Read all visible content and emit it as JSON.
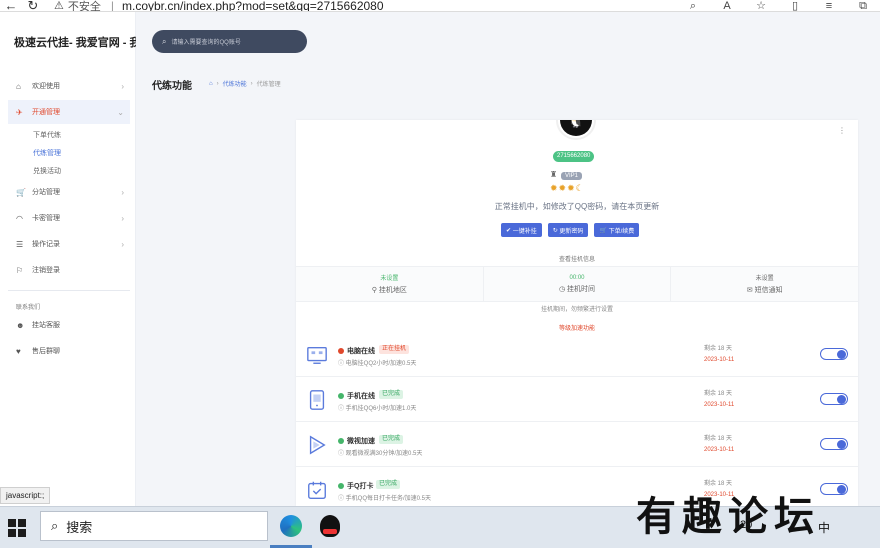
{
  "browser": {
    "back_icon": "back-arrow-icon",
    "reload_icon": "reload-icon",
    "insecure_label": "不安全",
    "url": "m.coybr.cn/index.php?mod=set&qq=2715662080"
  },
  "sidebar": {
    "brand": "极速云代挂- 我爱官网 - 我",
    "items": [
      {
        "label": "欢迎使用",
        "icon": "home-icon"
      },
      {
        "label": "开通管理",
        "icon": "rocket-icon"
      },
      {
        "label": "分站管理",
        "icon": "cart-icon"
      },
      {
        "label": "卡密管理",
        "icon": "wifi-icon"
      },
      {
        "label": "操作记录",
        "icon": "list-icon"
      },
      {
        "label": "注销登录",
        "icon": "logout-icon"
      }
    ],
    "sub_items": [
      "下单代练",
      "代练管理",
      "兑换活动"
    ],
    "section_label": "联系我们",
    "contact_items": [
      {
        "label": "挂站客服",
        "icon": "support-icon"
      },
      {
        "label": "售后群聊",
        "icon": "heart-icon"
      }
    ]
  },
  "search": {
    "placeholder": "请输入需要查询的QQ账号"
  },
  "page": {
    "title": "代练功能",
    "crumbs": [
      "代练功能",
      "代练管理"
    ]
  },
  "card": {
    "qq": "2715662080",
    "vip_label": "VIP1",
    "status_text": "正常挂机中，如修改了QQ密码，请在本页更新",
    "buttons": [
      "一键补挂",
      "更新密码",
      "下单/续费"
    ],
    "caption": "查看挂机信息",
    "stats": [
      {
        "value": "未设置",
        "label": "挂机地区"
      },
      {
        "value": "00:00",
        "label": "挂机时间"
      },
      {
        "value": "未设置",
        "label": "短信通知"
      }
    ],
    "note": "挂机期间，勿频繁进行设置",
    "section_title": "等级加速功能",
    "rows": [
      {
        "name": "电脑在线",
        "tag": "正在挂机",
        "desc": "电脑挂QQ2小时/加速0.5天",
        "remain": "剩余 18 天",
        "date": "2023-10-11"
      },
      {
        "name": "手机在线",
        "tag": "已完成",
        "desc": "手机挂QQ6小时/加速1.0天",
        "remain": "剩余 18 天",
        "date": "2023-10-11"
      },
      {
        "name": "微视加速",
        "tag": "已完成",
        "desc": "观看微视满30分钟/加速0.5天",
        "remain": "剩余 18 天",
        "date": "2023-10-11"
      },
      {
        "name": "手Q打卡",
        "tag": "已完成",
        "desc": "手机QQ每日打卡任务/加速0.5天",
        "remain": "剩余 18 天",
        "date": "2023-10-11"
      }
    ]
  },
  "statusbar": {
    "text": "javascript:;"
  },
  "taskbar": {
    "search_label": "搜索",
    "tray_time": "20",
    "tray_lang": "中"
  },
  "watermark": {
    "text": "有趣论坛"
  },
  "colors": {
    "accent": "#4a69d9",
    "active_red": "#e0482c",
    "badge_green": "#4cc385"
  }
}
